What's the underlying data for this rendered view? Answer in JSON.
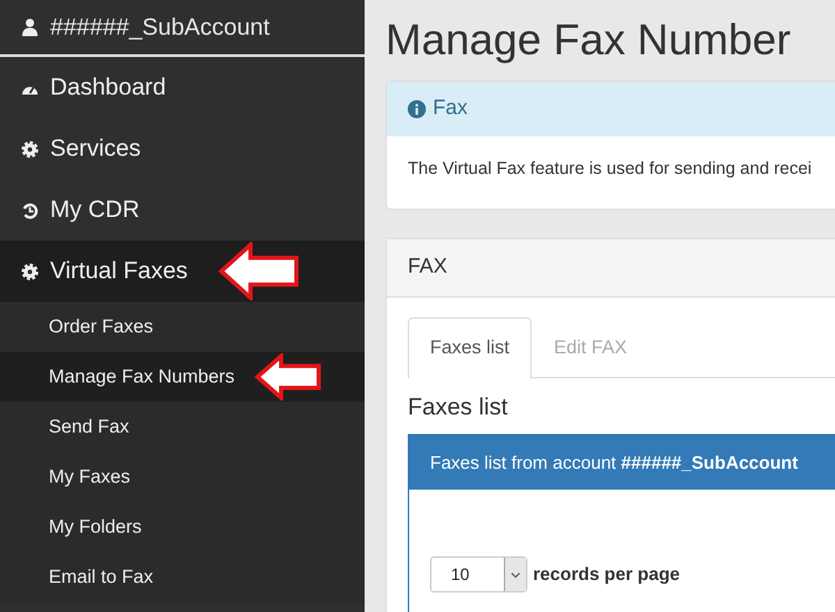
{
  "sidebar": {
    "user": "######_SubAccount",
    "items": [
      {
        "label": "Dashboard",
        "selected": false,
        "highlighted": false
      },
      {
        "label": "Services",
        "selected": false,
        "highlighted": false
      },
      {
        "label": "My CDR",
        "selected": false,
        "highlighted": false
      },
      {
        "label": "Virtual Faxes",
        "selected": true,
        "highlighted": true,
        "children": [
          {
            "label": "Order Faxes",
            "selected": false,
            "highlighted": false
          },
          {
            "label": "Manage Fax Numbers",
            "selected": true,
            "highlighted": true
          },
          {
            "label": "Send Fax",
            "selected": false,
            "highlighted": false
          },
          {
            "label": "My Faxes",
            "selected": false,
            "highlighted": false
          },
          {
            "label": "My Folders",
            "selected": false,
            "highlighted": false
          },
          {
            "label": "Email to Fax",
            "selected": false,
            "highlighted": false
          }
        ]
      }
    ]
  },
  "page_title": "Manage Fax Number",
  "info_panel": {
    "title": "Fax",
    "text": "The Virtual Fax feature is used for sending and recei"
  },
  "fax_panel": {
    "title": "FAX",
    "tabs": [
      {
        "label": "Faxes list",
        "selected": true
      },
      {
        "label": "Edit FAX",
        "selected": false
      }
    ],
    "heading": "Faxes list",
    "list_header": "Faxes list from account **######_SubAccount**",
    "page_size": "10",
    "page_size_label": "records per page"
  }
}
